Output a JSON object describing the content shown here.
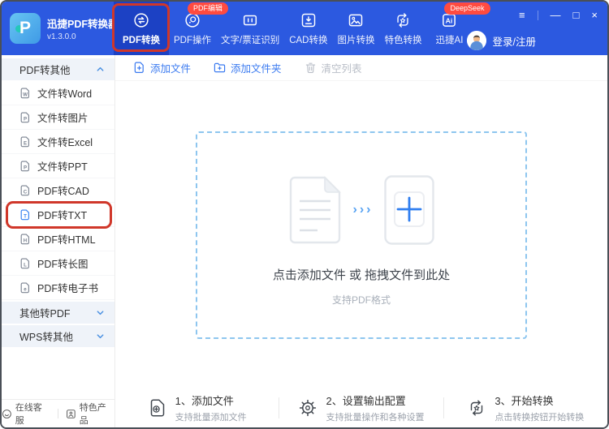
{
  "app": {
    "name": "迅捷PDF转换器",
    "version": "v1.3.0.0"
  },
  "header": {
    "tabs": [
      {
        "label": "PDF转换",
        "active": true
      },
      {
        "label": "PDF操作",
        "badge": "PDF编辑"
      },
      {
        "label": "文字/票证识别"
      },
      {
        "label": "CAD转换"
      },
      {
        "label": "图片转换"
      },
      {
        "label": "特色转换"
      },
      {
        "label": "迅捷AI",
        "badge": "DeepSeek",
        "icon_text": "Ai"
      }
    ],
    "login_label": "登录/注册",
    "controls": {
      "menu": "≡",
      "minimize": "—",
      "maximize": "□",
      "close": "×"
    }
  },
  "sidebar": {
    "sections": {
      "pdf_to_other": "PDF转其他",
      "other_to_pdf": "其他转PDF",
      "wps_to_other": "WPS转其他"
    },
    "items": [
      {
        "label": "文件转Word",
        "icon": "W"
      },
      {
        "label": "文件转图片",
        "icon": "P"
      },
      {
        "label": "文件转Excel",
        "icon": "E"
      },
      {
        "label": "文件转PPT",
        "icon": "P"
      },
      {
        "label": "PDF转CAD",
        "icon": "C"
      },
      {
        "label": "PDF转TXT",
        "icon": "T",
        "highlighted": true
      },
      {
        "label": "PDF转HTML",
        "icon": "H"
      },
      {
        "label": "PDF转长图",
        "icon": "L"
      },
      {
        "label": "PDF转电子书",
        "icon": "e"
      }
    ],
    "footer": {
      "online_service": "在线客服",
      "featured_products": "特色产品"
    }
  },
  "toolbar": {
    "add_file": "添加文件",
    "add_folder": "添加文件夹",
    "clear_list": "清空列表"
  },
  "dropzone": {
    "main_text": "点击添加文件 或 拖拽文件到此处",
    "sub_text": "支持PDF格式",
    "arrows": "›››"
  },
  "steps": [
    {
      "title": "1、添加文件",
      "subtitle": "支持批量添加文件"
    },
    {
      "title": "2、设置输出配置",
      "subtitle": "支持批量操作和各种设置"
    },
    {
      "title": "3、开始转换",
      "subtitle": "点击转换按钮开始转换"
    }
  ],
  "colors": {
    "header_blue": "#2c59e0",
    "active_tab_blue": "#1c41c4",
    "accent_blue": "#3a7af0",
    "annotation_red": "#d0372a",
    "badge_red": "#ff4b40",
    "dropzone_border_blue": "#8ec6ef"
  }
}
